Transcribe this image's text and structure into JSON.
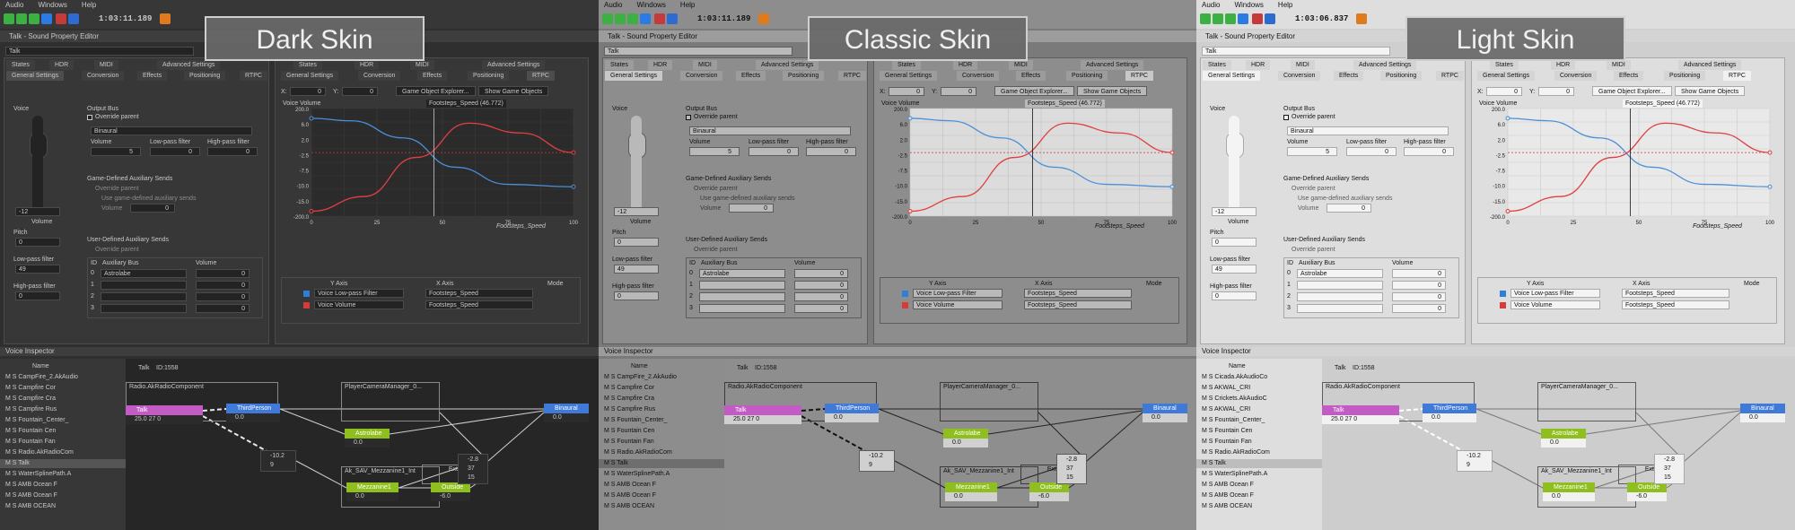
{
  "menu": [
    "Audio",
    "Windows",
    "Help"
  ],
  "skins": [
    {
      "label": "Dark Skin",
      "timecode": "1:03:11.189",
      "colors": {
        "bg": "#2f2f2f",
        "panel": "#373737",
        "field": "#232323",
        "border": "#4b4b4b",
        "text": "#c8c8c8",
        "dim": "#8a8a8a",
        "tab": "#3e3e3e",
        "tab_active": "#4d4d4d",
        "graph_bg": "#2b2b2b",
        "graph_grid": "#3b3b3b",
        "node": "#2b2b2b",
        "canvas": "#262626",
        "wire": "#cfcfcf",
        "wire_strong": "#e8e8e8",
        "selected": "#555555"
      }
    },
    {
      "label": "Classic Skin",
      "timecode": "1:03:11.189",
      "colors": {
        "bg": "#7a7a7a",
        "panel": "#8d8d8d",
        "field": "#b9b9b9",
        "border": "#5d5d5d",
        "text": "#111111",
        "dim": "#3a3a3a",
        "tab": "#9c9c9c",
        "tab_active": "#c8c8c8",
        "graph_bg": "#dcdcdc",
        "graph_grid": "#c0c0c0",
        "node": "#d0d0d0",
        "canvas": "#8e8e8e",
        "wire": "#222222",
        "wire_strong": "#111111",
        "selected": "#6e6e6e"
      }
    },
    {
      "label": "Light Skin",
      "timecode": "1:03:06.837",
      "colors": {
        "bg": "#cfcfcf",
        "panel": "#dedede",
        "field": "#f4f4f4",
        "border": "#a9a9a9",
        "text": "#151515",
        "dim": "#5c5c5c",
        "tab": "#d4d4d4",
        "tab_active": "#f1f1f1",
        "graph_bg": "#e9e9e9",
        "graph_grid": "#cbcbcb",
        "node": "#f1f1f1",
        "canvas": "#cdcdcd",
        "wire": "#777777",
        "wire_strong": "#ffffff",
        "selected": "#bdbdbd"
      }
    }
  ],
  "spe": {
    "window_title": "Talk - Sound Property Editor",
    "object_name": "Talk",
    "tabs_row1": [
      "States",
      "HDR",
      "MIDI",
      "Advanced Settings"
    ],
    "tabs_row2": [
      "General Settings",
      "Conversion",
      "Effects",
      "Positioning",
      "RTPC"
    ],
    "voice_label": "Voice",
    "volume_value": "-12",
    "volume_label": "Volume",
    "pitch_label": "Pitch",
    "pitch_value": "0",
    "lowpass_label": "Low-pass filter",
    "lowpass_value": "49",
    "highpass_label": "High-pass filter",
    "highpass_value": "0",
    "output_bus_heading": "Output Bus",
    "override_parent": "Override parent",
    "bus_name": "Binaural",
    "bus_volume_label": "Volume",
    "bus_volume": "5",
    "bus_lpf_label": "Low-pass filter",
    "bus_lpf": "0",
    "bus_hpf_label": "High-pass filter",
    "bus_hpf": "0",
    "game_defined_heading": "Game-Defined Auxiliary Sends",
    "use_game_defined": "Use game-defined auxiliary sends",
    "gd_volume_label": "Volume",
    "gd_volume": "0",
    "user_defined_heading": "User-Defined Auxiliary Sends",
    "aux_col_id": "ID",
    "aux_col_bus": "Auxiliary Bus",
    "aux_col_volume": "Volume",
    "aux_rows": [
      {
        "id": "0",
        "bus": "Astrolabe",
        "vol": "0"
      },
      {
        "id": "1",
        "bus": "",
        "vol": "0"
      },
      {
        "id": "2",
        "bus": "",
        "vol": "0"
      },
      {
        "id": "3",
        "bus": "",
        "vol": "0"
      }
    ]
  },
  "rtpc": {
    "x_label": "X:",
    "y_label": "Y:",
    "x_value": "0",
    "y_value": "0",
    "btn_explorer": "Game Object Explorer...",
    "btn_show": "Show Game Objects",
    "graph_y_title": "Voice Volume",
    "graph_x_title": "Footsteps_Speed",
    "marker_label": "Footsteps_Speed (46.772)",
    "y_ticks": [
      "200.0",
      "6.0",
      "2.0",
      "-2.5",
      "-7.5",
      "-10.0",
      "-15.0",
      "-200.0"
    ],
    "x_ticks": [
      "0",
      "25",
      "50",
      "75",
      "100"
    ],
    "table_headers": [
      "Y Axis",
      "X Axis",
      "Mode"
    ],
    "rows": [
      {
        "y": "Voice Low-pass Filter",
        "x": "Footsteps_Speed",
        "color": "#2f7ed8"
      },
      {
        "y": "Voice Volume",
        "x": "Footsteps_Speed",
        "color": "#d83a3a"
      }
    ]
  },
  "chart_data": {
    "type": "line",
    "title": "",
    "xlabel": "Footsteps_Speed",
    "ylabel": "Voice Volume",
    "xlim": [
      0,
      100
    ],
    "marker_x": 46.772,
    "series": [
      {
        "name": "Voice Low-pass Filter",
        "color": "#4a90d9",
        "points": [
          [
            0,
            7
          ],
          [
            15,
            6.5
          ],
          [
            35,
            3
          ],
          [
            55,
            -3
          ],
          [
            75,
            -6.5
          ],
          [
            100,
            -7
          ]
        ]
      },
      {
        "name": "Voice Volume",
        "color": "#e04040",
        "points": [
          [
            0,
            -12
          ],
          [
            20,
            -9
          ],
          [
            40,
            -1
          ],
          [
            60,
            6
          ],
          [
            80,
            4
          ],
          [
            100,
            0
          ]
        ]
      }
    ]
  },
  "voice_inspector": {
    "title": "Voice Inspector",
    "tree_header": "Name",
    "tree_rows": [
      [
        "CampFire_2.AkAudio",
        "Campfire Cor",
        "Campfire Cra",
        "Campfire Rus",
        "Fountain_Center_",
        "Fountain Cen",
        "Fountain Fan",
        "Radio.AkRadioCom",
        "Talk",
        "WaterSplinePath.A",
        "AMB Ocean F",
        "AMB Ocean F",
        "AMB OCEAN"
      ],
      [
        "CampFire_2.AkAudio",
        "Campfire Cor",
        "Campfire Cra",
        "Campfire Rus",
        "Fountain_Center_",
        "Fountain Cen",
        "Fountain Fan",
        "Radio.AkRadioCom",
        "Talk",
        "WaterSplinePath.A",
        "AMB Ocean F",
        "AMB Ocean F",
        "AMB OCEAN"
      ],
      [
        "Cicada.AkAudioCo",
        "AKWAL_CRI",
        "Crickets.AkAudioC",
        "AKWAL_CRI",
        "Fountain_Center_",
        "Fountain Cen",
        "Fountain Fan",
        "Radio.AkRadioCom",
        "Talk",
        "WaterSplinePath.A",
        "AMB Ocean F",
        "AMB Ocean F",
        "AMB OCEAN"
      ]
    ],
    "header_talk": "Talk",
    "header_id": "ID:1558",
    "nodes": {
      "radio_group": "Radio.AkRadioComponent",
      "player_group": "PlayerCameraManager_0...",
      "talk": "Talk",
      "talk_vals": [
        "25.0",
        "27",
        "0"
      ],
      "thirdperson": "ThirdPerson",
      "thirdperson_val": "0.0",
      "binaural": "Binaural",
      "binaural_val": "0.0",
      "astrolabe": "Astrolabe",
      "astrolabe_val": "0.0",
      "mezz_group": "Ak_SAV_Mezzanine1_Int",
      "mezzanine": "Mezzanine1",
      "mezzanine_val": "0.0",
      "exterior": "Exterior",
      "outside": "Outside",
      "outside_val": "-6.0",
      "a_vals": [
        "-10.2",
        "9"
      ],
      "b_vals": [
        "-2.8",
        "37",
        "15"
      ]
    }
  }
}
